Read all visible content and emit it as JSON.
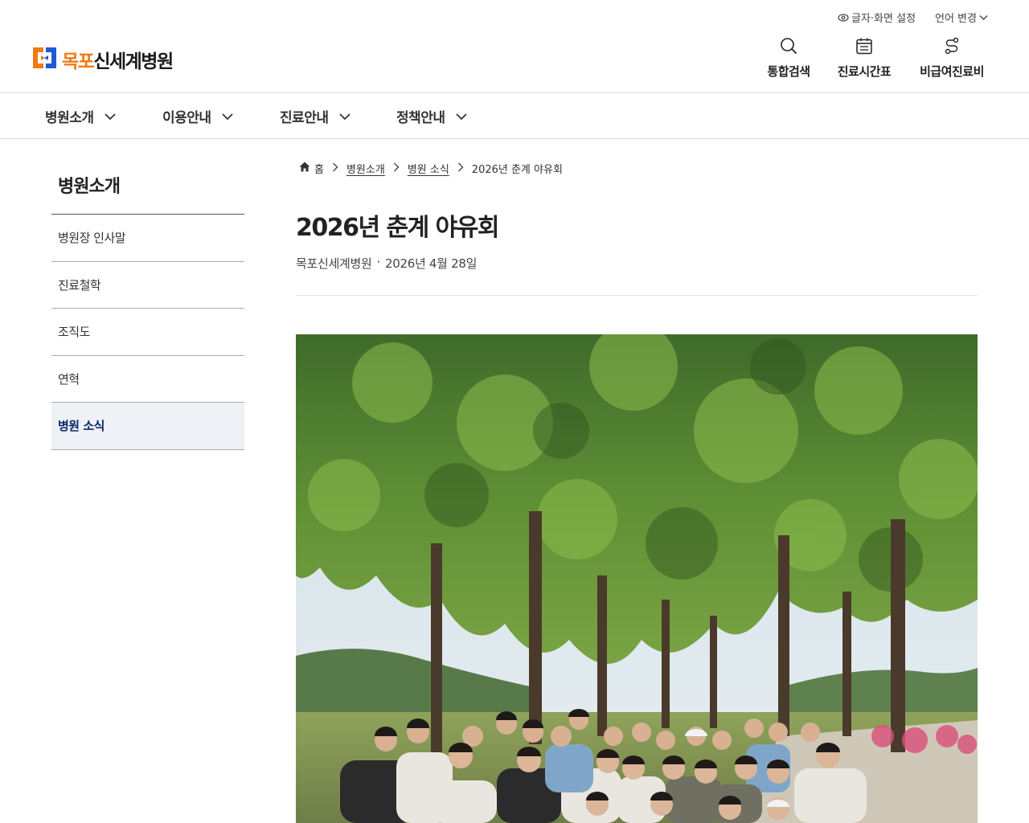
{
  "utility": {
    "text_setting": "글자·화면 설정",
    "language": "언어 변경"
  },
  "logo": {
    "accent": "목포",
    "text": "신세계병원"
  },
  "quick_links": {
    "search": "통합검색",
    "hours": "진료시간표",
    "fees": "비급여진료비"
  },
  "gnb": [
    "병원소개",
    "이용안내",
    "진료안내",
    "정책안내"
  ],
  "lnb": {
    "title": "병원소개",
    "items": [
      "병원장 인사말",
      "진료철학",
      "조직도",
      "연혁",
      "병원 소식"
    ],
    "active_index": 4
  },
  "breadcrumb": {
    "home": "홈",
    "level1": "병원소개",
    "level2": "병원 소식",
    "current": "2026년 춘계 야유회"
  },
  "post": {
    "title": "2026년 춘계 야유회",
    "author": "목포신세계병원",
    "separator": "·",
    "date": "2026년 4월 28일"
  },
  "colors": {
    "brand_orange": "#f07a14",
    "brand_blue": "#1f5ad6",
    "active_text": "#0b2a66",
    "active_bg": "#eef1f6"
  }
}
